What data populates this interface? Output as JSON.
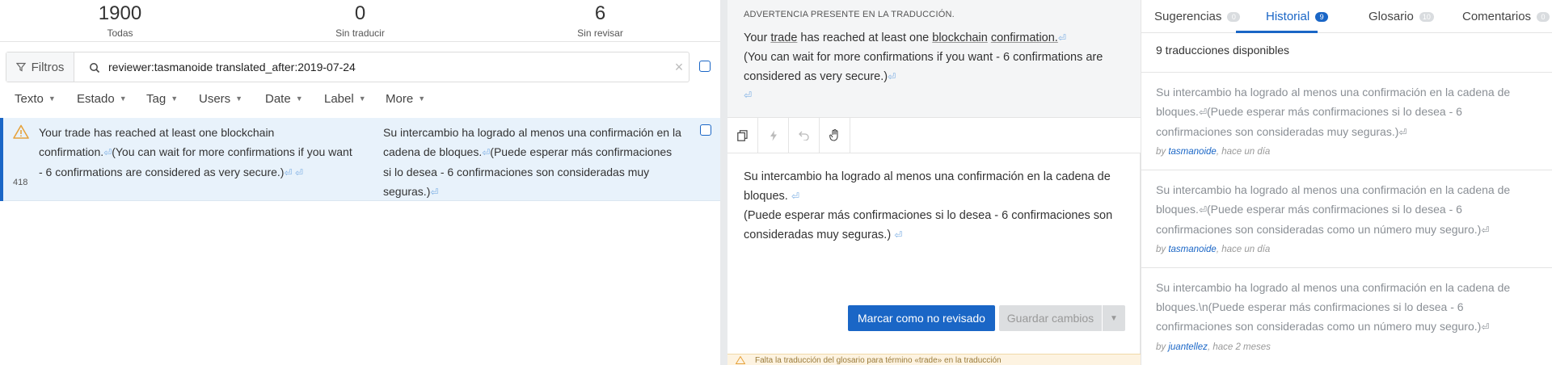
{
  "stats": [
    {
      "value": "1900",
      "label": "Todas"
    },
    {
      "value": "0",
      "label": "Sin traducir"
    },
    {
      "value": "6",
      "label": "Sin revisar"
    }
  ],
  "filters": {
    "button_label": "Filtros",
    "search_value": "reviewer:tasmanoide translated_after:2019-07-24"
  },
  "dropdowns": [
    "Texto",
    "Estado",
    "Tag",
    "Users",
    "Date",
    "Label",
    "More"
  ],
  "unit": {
    "id": "418",
    "source_line1": "Your trade has reached at least one blockchain",
    "source_line2": "confirmation.",
    "source_line3": "(You can wait for more confirmations if you want",
    "source_line4": "- 6 confirmations are considered as very secure.)",
    "target_line1": "Su intercambio ha logrado al menos una confirmación en la",
    "target_line2": "cadena de bloques.",
    "target_line3": "(Puede esperar más confirmaciones",
    "target_line4": "si lo desea - 6 confirmaciones son consideradas muy",
    "target_line5": "seguras.)"
  },
  "editor": {
    "warning_label": "ADVERTENCIA PRESENTE EN LA TRADUCCIÓN.",
    "source_part1": "Your ",
    "source_trade": "trade",
    "source_part2": " has reached at least one ",
    "source_blockchain": "blockchain",
    "source_part3": " ",
    "source_confirmation": "confirmation.",
    "source_line2": "(You can wait for more confirmations if you want - 6 confirmations are",
    "source_line3": "considered as very secure.)",
    "target_line1": "Su intercambio ha logrado al menos una confirmación en la cadena de",
    "target_line2": "bloques.",
    "target_line3": "(Puede esperar más confirmaciones si lo desea - 6 confirmaciones son",
    "target_line4": "consideradas muy seguras.)",
    "unreview_button": "Marcar como no revisado",
    "save_button": "Guardar cambios",
    "glossary_warning": "Falta la traducción del glosario para término «trade» en la traducción"
  },
  "sidebar_tabs": [
    {
      "label": "Sugerencias",
      "count": "0"
    },
    {
      "label": "Historial",
      "count": "9"
    },
    {
      "label": "Glosario",
      "count": "10"
    },
    {
      "label": "Comentarios",
      "count": "0"
    }
  ],
  "history": {
    "count_label": "9 traducciones disponibles",
    "items": [
      {
        "line1": "Su intercambio ha logrado al menos una confirmación en la cadena de",
        "line2a": "bloques.",
        "line2b": "(Puede esperar más confirmaciones si lo desea - 6",
        "line3": "confirmaciones son consideradas muy seguras.)",
        "by": "by ",
        "user": "tasmanoide",
        "time": ", hace un día"
      },
      {
        "line1": "Su intercambio ha logrado al menos una confirmación en la cadena de",
        "line2a": "bloques.",
        "line2b": "(Puede esperar más confirmaciones si lo desea - 6",
        "line3": "confirmaciones son consideradas como un número muy seguro.)",
        "by": "by ",
        "user": "tasmanoide",
        "time": ", hace un día"
      },
      {
        "line1": "Su intercambio ha logrado al menos una confirmación en la cadena de",
        "line2a": "bloques.\\n(Puede esperar más confirmaciones si lo desea - 6",
        "line2b": "",
        "line3": "confirmaciones son consideradas como un número muy seguro.)",
        "by": "by ",
        "user": "juantellez",
        "time": ", hace 2 meses"
      }
    ]
  },
  "colors": {
    "accent": "#1a66c6",
    "warning": "#e6a23c"
  }
}
